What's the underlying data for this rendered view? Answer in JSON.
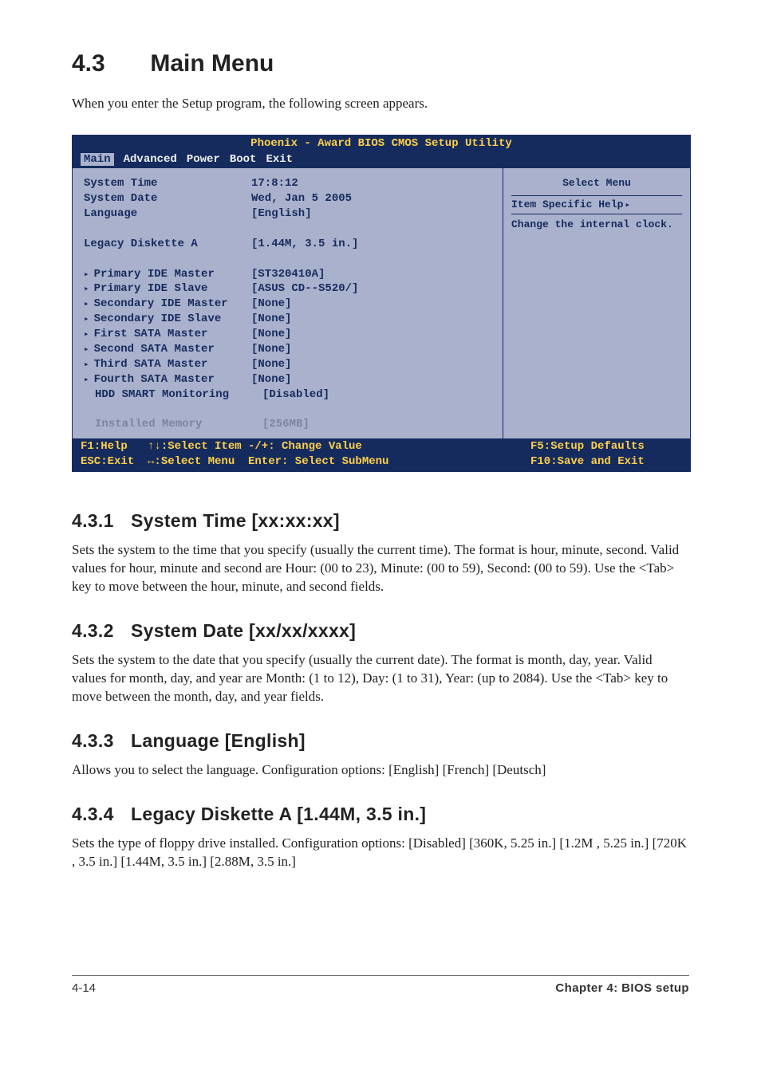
{
  "section": {
    "number": "4.3",
    "title": "Main Menu"
  },
  "intro": "When you enter the Setup program, the following screen appears.",
  "bios": {
    "title": "Phoenix - Award BIOS CMOS Setup Utility",
    "menu": {
      "active": "Main",
      "items": [
        "Main",
        "Advanced",
        "Power",
        "Boot",
        "Exit"
      ]
    },
    "rows": [
      {
        "label": "System Time",
        "value": "17:8:12",
        "arrow": false
      },
      {
        "label": "System Date",
        "value": "Wed, Jan 5 2005",
        "arrow": false
      },
      {
        "label": "Language",
        "value": "[English]",
        "arrow": false,
        "blank_after": true
      },
      {
        "label": "Legacy Diskette A",
        "value": "[1.44M, 3.5 in.]",
        "arrow": false,
        "blank_after": true
      },
      {
        "label": "Primary IDE Master",
        "value": "[ST320410A]",
        "arrow": true
      },
      {
        "label": "Primary IDE Slave",
        "value": "[ASUS CD--S520/]",
        "arrow": true
      },
      {
        "label": "Secondary IDE Master",
        "value": "[None]",
        "arrow": true
      },
      {
        "label": "Secondary IDE Slave",
        "value": "[None]",
        "arrow": true
      },
      {
        "label": "First SATA Master",
        "value": "[None]",
        "arrow": true
      },
      {
        "label": "Second SATA Master",
        "value": "[None]",
        "arrow": true
      },
      {
        "label": "Third SATA Master",
        "value": "[None]",
        "arrow": true
      },
      {
        "label": "Fourth SATA Master",
        "value": "[None]",
        "arrow": true
      },
      {
        "label": "HDD SMART Monitoring",
        "value": "[Disabled]",
        "arrow": false,
        "indent": true,
        "blank_after": true
      },
      {
        "label": "Installed Memory",
        "value": "[256MB]",
        "arrow": false,
        "indent": true,
        "muted": true
      }
    ],
    "help": {
      "select_menu": "Select Menu",
      "item_specific": "Item Specific Help",
      "text": "Change the internal clock."
    },
    "footer": {
      "l1a": "F1:Help   ↑↓:Select Item",
      "l2a": "ESC:Exit  ↔:Select Menu",
      "l1b": "-/+: Change Value",
      "l2b": "Enter: Select SubMenu",
      "l1c": "F5:Setup Defaults",
      "l2c": "F10:Save and Exit"
    }
  },
  "subs": [
    {
      "num": "4.3.1",
      "title": "System Time [xx:xx:xx]",
      "body": "Sets the system to the time that you specify (usually the current time). The format is hour, minute, second. Valid values for hour, minute and second are Hour: (00 to 23), Minute: (00 to 59), Second: (00 to 59). Use the <Tab> key to move between the hour, minute, and second fields."
    },
    {
      "num": "4.3.2",
      "title": "System Date [xx/xx/xxxx]",
      "body": "Sets the system to the date that you specify (usually the current date). The format is month, day, year. Valid values for month, day, and year are Month: (1 to 12), Day: (1 to 31), Year: (up to 2084). Use the <Tab> key to move between the month, day, and year fields."
    },
    {
      "num": "4.3.3",
      "title": "Language [English]",
      "body": "Allows you to select the language. Configuration options: [English] [French] [Deutsch]"
    },
    {
      "num": "4.3.4",
      "title": "Legacy Diskette A [1.44M, 3.5 in.]",
      "body": "Sets the type of floppy drive installed. Configuration options: [Disabled] [360K, 5.25 in.] [1.2M , 5.25 in.] [720K , 3.5 in.] [1.44M, 3.5 in.] [2.88M, 3.5 in.]"
    }
  ],
  "footer": {
    "left": "4-14",
    "right": "Chapter 4: BIOS setup"
  }
}
